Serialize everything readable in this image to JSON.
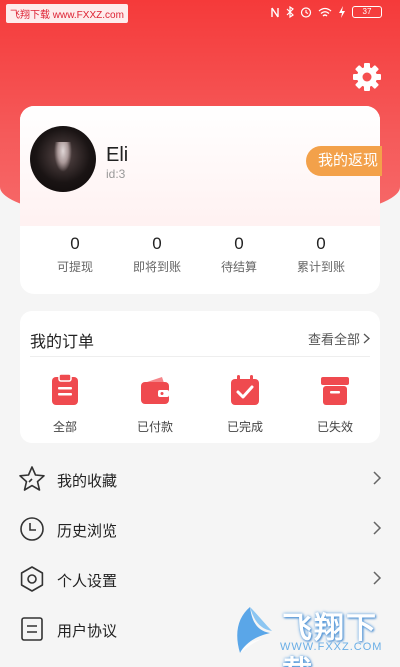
{
  "status_bar": {
    "watermark_left": "飞翔下载 www.FXXZ.com",
    "battery": "37"
  },
  "profile": {
    "name": "Eli",
    "id": "id:3",
    "rebate_button": "我的返现",
    "stats": [
      {
        "value": "0",
        "label": "可提现"
      },
      {
        "value": "0",
        "label": "即将到账"
      },
      {
        "value": "0",
        "label": "待结算"
      },
      {
        "value": "0",
        "label": "累计到账"
      }
    ]
  },
  "orders": {
    "title": "我的订单",
    "view_all": "查看全部",
    "items": [
      {
        "label": "全部",
        "icon": "clipboard-list-icon"
      },
      {
        "label": "已付款",
        "icon": "wallet-icon"
      },
      {
        "label": "已完成",
        "icon": "calendar-check-icon"
      },
      {
        "label": "已失效",
        "icon": "box-icon"
      }
    ]
  },
  "menu": [
    {
      "label": "我的收藏",
      "icon": "star-icon"
    },
    {
      "label": "历史浏览",
      "icon": "clock-icon"
    },
    {
      "label": "个人设置",
      "icon": "settings-icon"
    },
    {
      "label": "用户协议",
      "icon": "document-icon"
    }
  ],
  "watermark": {
    "brand": "飞翔下载",
    "url": "WWW.FXXZ.COM"
  },
  "colors": {
    "primary": "#f53a3a",
    "accent": "#f3a14a",
    "icon_red": "#ef4a4f"
  }
}
